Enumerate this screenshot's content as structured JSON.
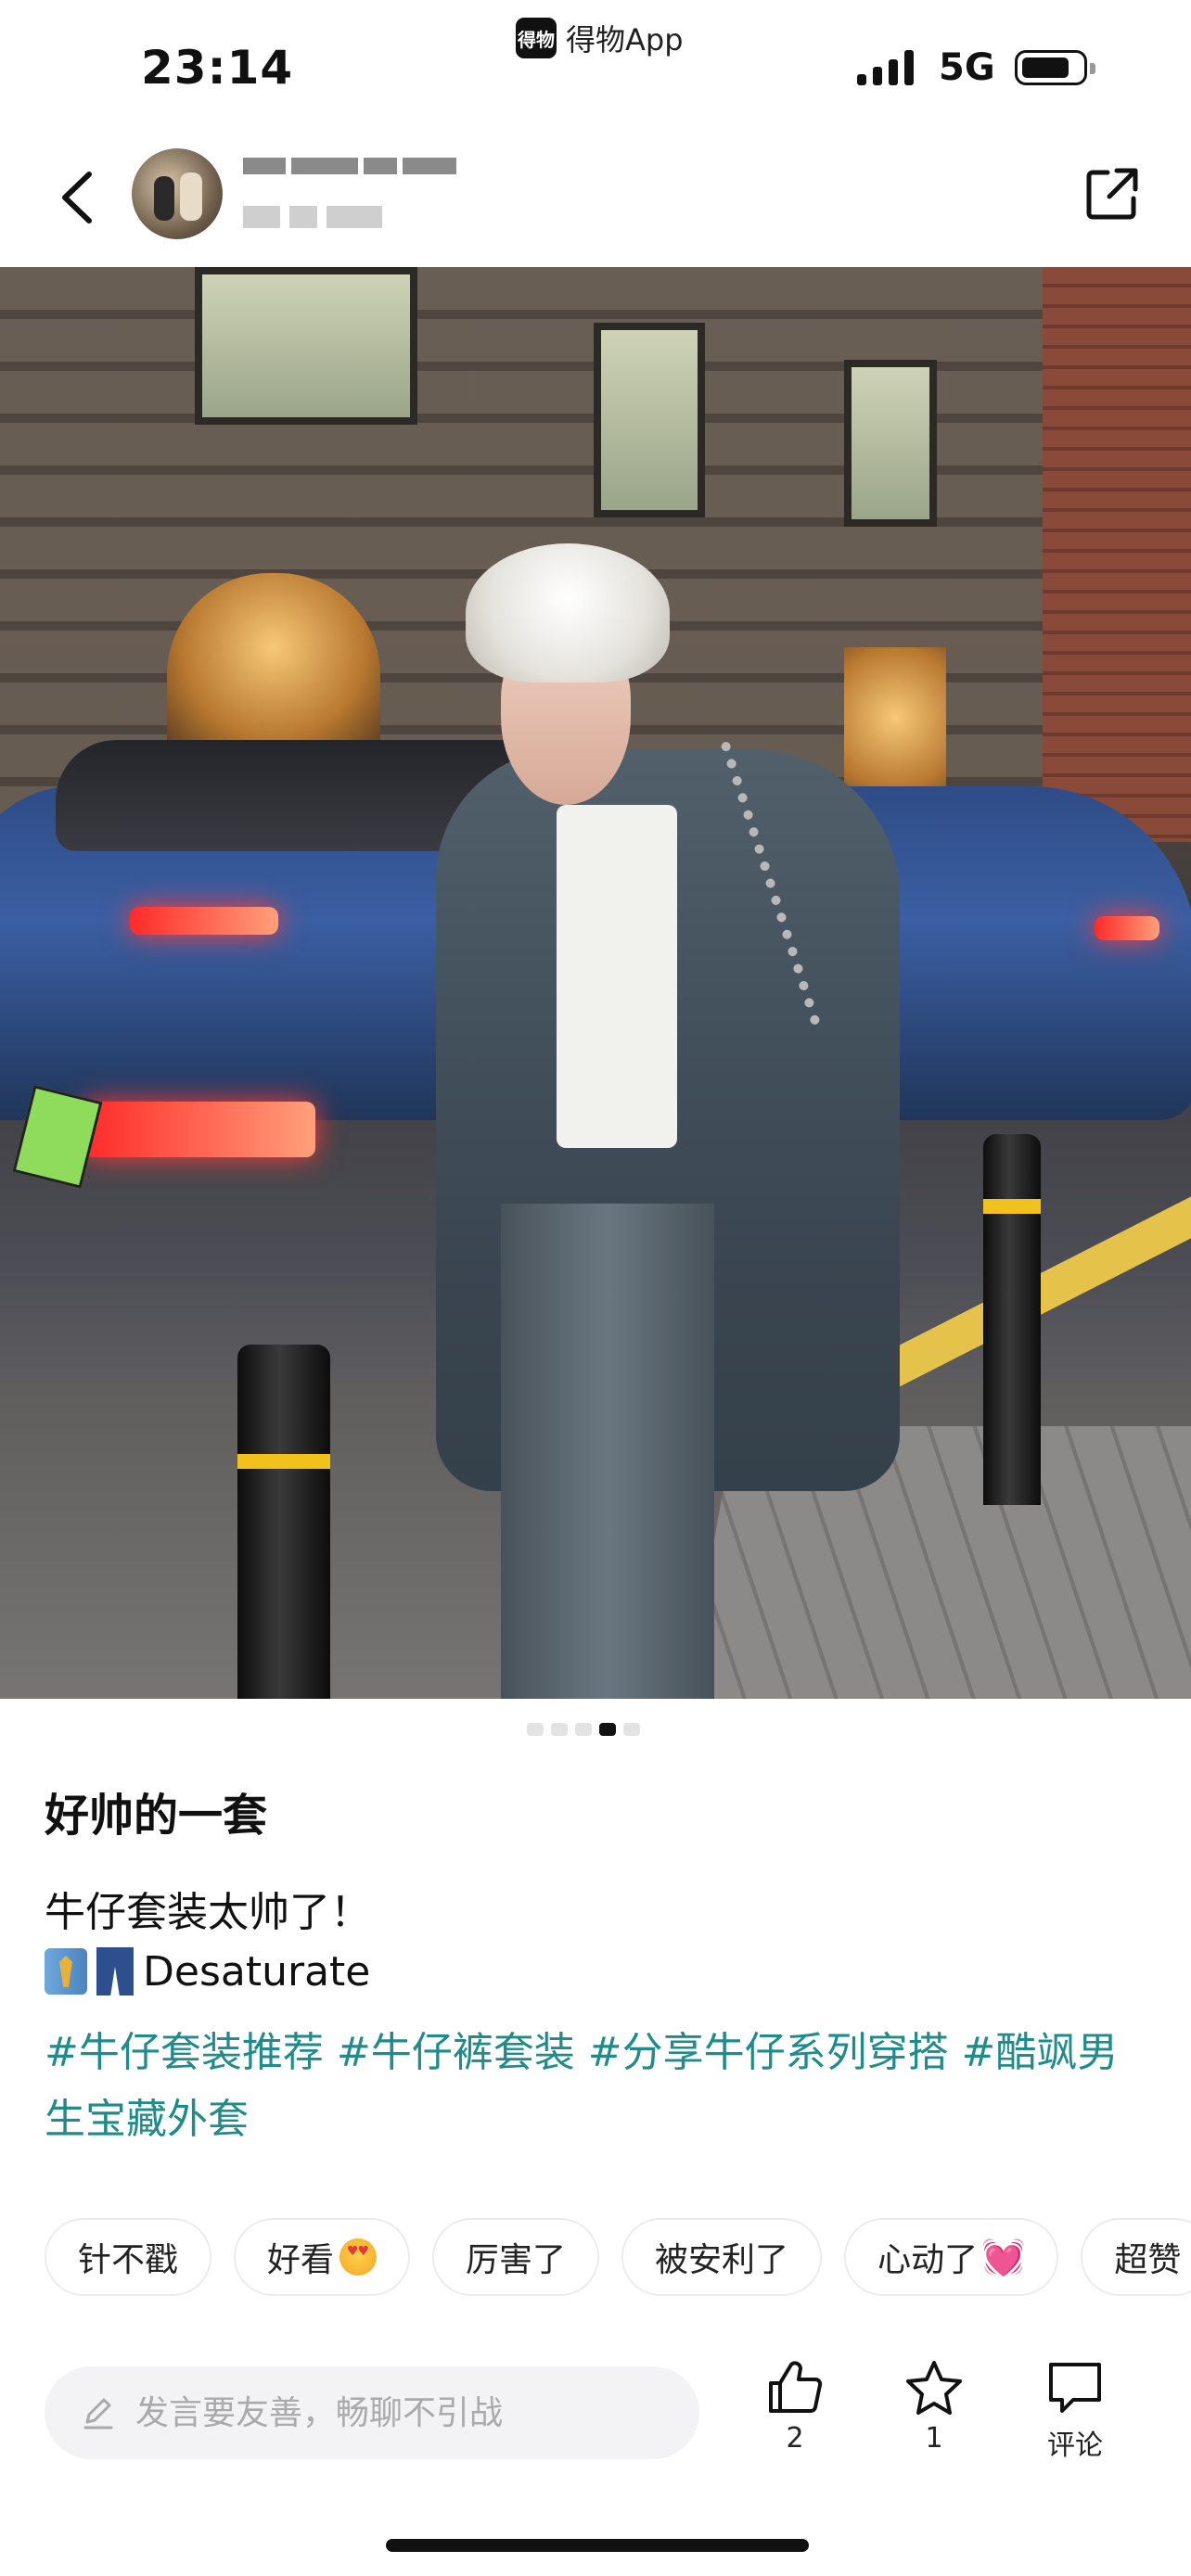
{
  "status_bar": {
    "time": "23:14",
    "app_name": "得物App",
    "app_logo_text": "得物",
    "network": "5G"
  },
  "header": {
    "back_icon": "chevron-left-icon",
    "share_icon": "external-share-icon"
  },
  "carousel": {
    "total": 5,
    "active_index": 3
  },
  "post": {
    "title": "好帅的一套",
    "line1": "牛仔套装太帅了！",
    "line2_text": "Desaturate",
    "tags": "#牛仔套装推荐 #牛仔裤套装 #分享牛仔系列穿搭 #酷飒男生宝藏外套"
  },
  "quick_replies": [
    {
      "label": "针不戳"
    },
    {
      "label": "好看"
    },
    {
      "label": "厉害了"
    },
    {
      "label": "被安利了"
    },
    {
      "label": "心动了"
    },
    {
      "label": "超赞"
    }
  ],
  "bottom_bar": {
    "input_placeholder": "发言要友善，畅聊不引战",
    "like_count": "2",
    "favorite_count": "1",
    "comment_label": "评论"
  },
  "colors": {
    "tag_color": "#1f8b8b",
    "text": "#111111",
    "input_bg": "#f3f3f6"
  }
}
